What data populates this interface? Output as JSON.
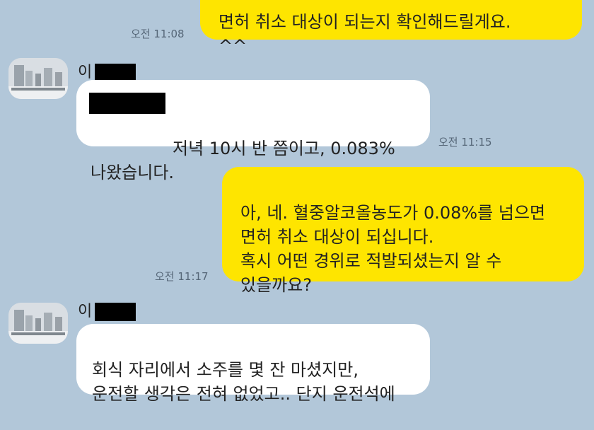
{
  "messages": [
    {
      "id": "m1",
      "side": "me",
      "text": "면허 취소 대상이 되는지 확인해드릴게요.\n^^",
      "time": "오전 11:08"
    },
    {
      "id": "m2",
      "side": "them",
      "sender": "이",
      "text": "저녁 10시 반 쯤이고, 0.083%\n나왔습니다.",
      "time": "오전 11:15"
    },
    {
      "id": "m3",
      "side": "me",
      "text": "아, 네. 혈중알코올농도가 0.08%를 넘으면\n면허 취소 대상이 되십니다.\n혹시 어떤 경위로 적발되셨는지 알 수\n있을까요?",
      "time": "오전 11:17"
    },
    {
      "id": "m4",
      "side": "them",
      "sender": "이",
      "text": "회식 자리에서 소주를 몇 잔 마셨지만,\n운전할 생각은 전혀 없었고.. 단지 운전석에"
    }
  ],
  "colors": {
    "background": "#b2c7d9",
    "my_bubble": "#fee500",
    "their_bubble": "#ffffff"
  }
}
